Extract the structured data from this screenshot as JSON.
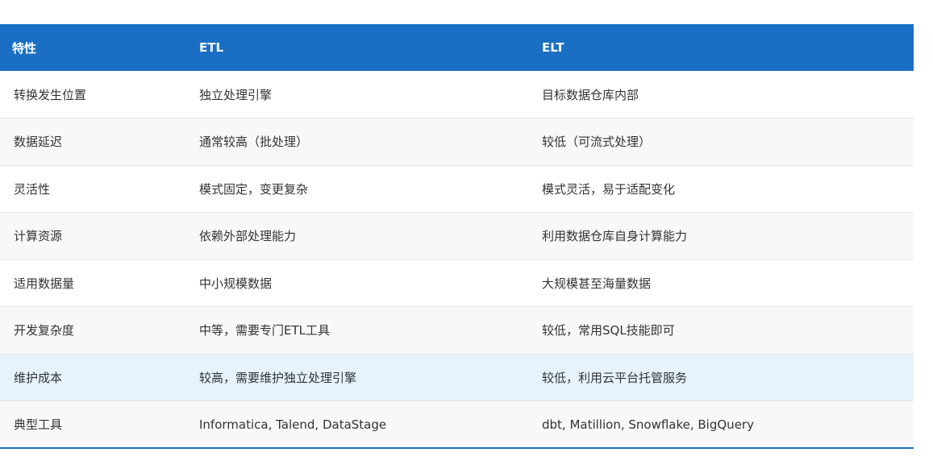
{
  "table": {
    "headers": [
      "特性",
      "ETL",
      "ELT"
    ],
    "rows": [
      [
        "转换发生位置",
        "独立处理引擎",
        "目标数据仓库内部"
      ],
      [
        "数据延迟",
        "通常较高（批处理）",
        "较低（可流式处理）"
      ],
      [
        "灵活性",
        "模式固定，变更复杂",
        "模式灵活，易于适配变化"
      ],
      [
        "计算资源",
        "依赖外部处理能力",
        "利用数据仓库自身计算能力"
      ],
      [
        "适用数据量",
        "中小规模数据",
        "大规模甚至海量数据"
      ],
      [
        "开发复杂度",
        "中等，需要专门ETL工具",
        "较低，常用SQL技能即可"
      ],
      [
        "维护成本",
        "较高，需要维护独立处理引擎",
        "较低，利用云平台托管服务"
      ],
      [
        "典型工具",
        "Informatica, Talend, DataStage",
        "dbt, Matillion, Snowflake, BigQuery"
      ]
    ]
  },
  "colors": {
    "header_bg": "#1a6fc4",
    "header_text": "#ffffff",
    "row_alt_bg": "#f6f8fa",
    "row_highlight_bg": "#e6f2fc",
    "body_text": "#333333"
  }
}
